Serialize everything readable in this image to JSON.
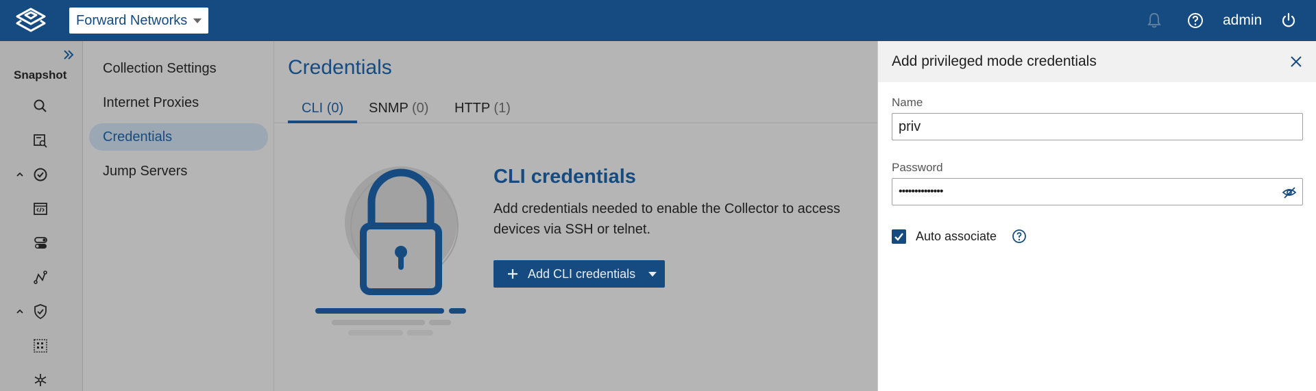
{
  "topbar": {
    "network_name": "Forward Networks",
    "user": "admin",
    "icons": [
      "logo-icon",
      "bell-icon",
      "help-icon",
      "power-icon"
    ]
  },
  "rail": {
    "title": "Snapshot",
    "icons": [
      "search-icon",
      "search-list-icon",
      "check-circle-icon",
      "code-icon",
      "toggle-icon",
      "path-icon",
      "shield-check-icon",
      "grid-icon",
      "snowflake-icon"
    ]
  },
  "settings_nav": {
    "items": [
      {
        "label": "Collection Settings"
      },
      {
        "label": "Internet Proxies"
      },
      {
        "label": "Credentials"
      },
      {
        "label": "Jump Servers"
      }
    ],
    "active_index": 2
  },
  "main": {
    "title": "Credentials",
    "tabs": [
      {
        "label": "CLI",
        "count": "(0)"
      },
      {
        "label": "SNMP",
        "count": "(0)"
      },
      {
        "label": "HTTP",
        "count": "(1)"
      }
    ],
    "empty_title": "CLI credentials",
    "empty_desc": "Add credentials needed to enable the Collector to access devices via SSH or telnet.",
    "add_button": "Add CLI credentials"
  },
  "panel": {
    "title": "Add privileged mode credentials",
    "name_label": "Name",
    "name_value": "priv",
    "password_label": "Password",
    "password_value": "••••••••••••••",
    "auto_associate_label": "Auto associate",
    "auto_associate_checked": true
  },
  "colors": {
    "brand": "#154b80",
    "overlay_bg": "#b5b5b5"
  }
}
